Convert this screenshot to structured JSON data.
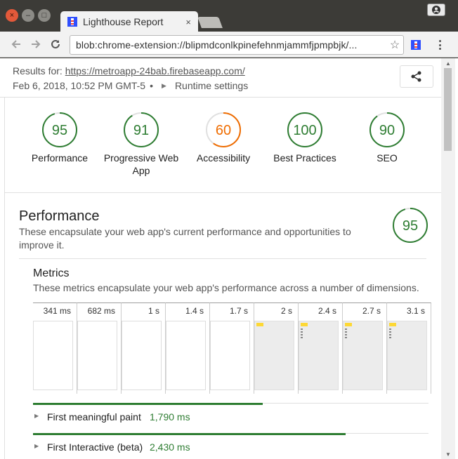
{
  "browser": {
    "tab_title": "Lighthouse Report",
    "tab_close": "×",
    "url": "blob:chrome-extension://blipmdconlkpinefehnmjammfjpmpbjk/...",
    "window_close": "×",
    "window_minimize": "–",
    "window_maximize": "□"
  },
  "header": {
    "results_for_label": "Results for:",
    "results_url": "https://metroapp-24bab.firebaseapp.com/",
    "date": "Feb 6, 2018, 10:52 PM GMT-5",
    "bullet": "•",
    "runtime_settings": "Runtime settings"
  },
  "colors": {
    "pass": "#2e7d32",
    "average": "#ef6c00",
    "track": "#e0e0e0"
  },
  "scores": [
    {
      "value": "95",
      "label": "Performance",
      "fraction": 0.95,
      "status": "pass"
    },
    {
      "value": "91",
      "label": "Progressive Web App",
      "fraction": 0.91,
      "status": "pass"
    },
    {
      "value": "60",
      "label": "Accessibility",
      "fraction": 0.6,
      "status": "average"
    },
    {
      "value": "100",
      "label": "Best Practices",
      "fraction": 1.0,
      "status": "pass"
    },
    {
      "value": "90",
      "label": "SEO",
      "fraction": 0.9,
      "status": "pass"
    }
  ],
  "performance": {
    "title": "Performance",
    "description": "These encapsulate your web app's current performance and opportunities to improve it.",
    "score": "95",
    "fraction": 0.95
  },
  "metrics": {
    "title": "Metrics",
    "description": "These metrics encapsulate your web app's performance across a number of dimensions.",
    "filmstrip": [
      {
        "time": "341 ms",
        "loaded": false
      },
      {
        "time": "682 ms",
        "loaded": false
      },
      {
        "time": "1 s",
        "loaded": false
      },
      {
        "time": "1.4 s",
        "loaded": false
      },
      {
        "time": "1.7 s",
        "loaded": false
      },
      {
        "time": "2 s",
        "loaded": true
      },
      {
        "time": "2.4 s",
        "loaded": true
      },
      {
        "time": "2.7 s",
        "loaded": true
      },
      {
        "time": "3.1 s",
        "loaded": true
      }
    ],
    "items": [
      {
        "name": "First meaningful paint",
        "value": "1,790 ms",
        "bar_fraction": 0.58
      },
      {
        "name": "First Interactive (beta)",
        "value": "2,430 ms",
        "bar_fraction": 0.79
      }
    ]
  }
}
